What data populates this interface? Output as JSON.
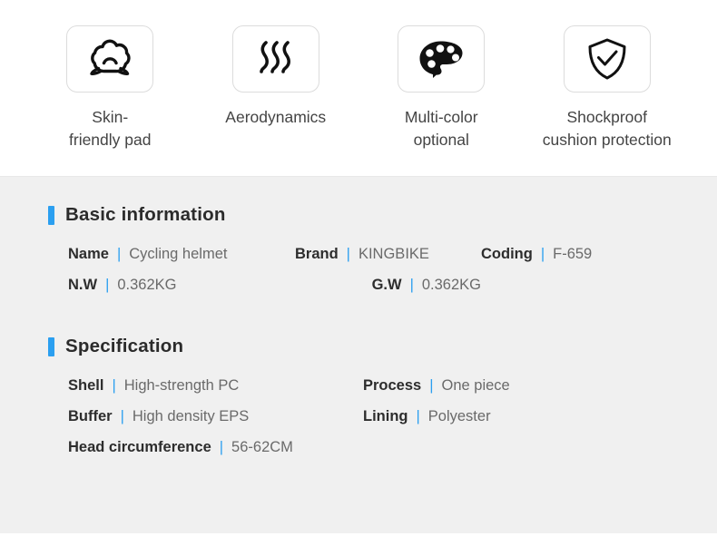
{
  "features": [
    {
      "icon": "cushion-cloud-icon",
      "label": "Skin-\nfriendly pad"
    },
    {
      "icon": "airflow-waves-icon",
      "label": "Aerodynamics"
    },
    {
      "icon": "color-palette-icon",
      "label": "Multi-color\noptional"
    },
    {
      "icon": "shield-check-icon",
      "label": "Shockproof\ncushion protection"
    }
  ],
  "basic_information": {
    "title": "Basic information",
    "separator": "|",
    "fields": {
      "name_label": "Name",
      "name_value": "Cycling helmet",
      "brand_label": "Brand",
      "brand_value": "KINGBIKE",
      "coding_label": "Coding",
      "coding_value": "F-659",
      "nw_label": "N.W",
      "nw_value": "0.362KG",
      "gw_label": "G.W",
      "gw_value": "0.362KG"
    }
  },
  "specification": {
    "title": "Specification",
    "separator": "|",
    "fields": {
      "shell_label": "Shell",
      "shell_value": "High-strength PC",
      "process_label": "Process",
      "process_value": "One piece",
      "buffer_label": "Buffer",
      "buffer_value": "High density EPS",
      "lining_label": "Lining",
      "lining_value": "Polyester",
      "head_label": "Head circumference",
      "head_value": "56-62CM"
    }
  },
  "colors": {
    "accent": "#2b9ff0",
    "panel_bg": "#f0f0f0",
    "label": "#2d2d2d",
    "value": "#6a6a6a"
  }
}
